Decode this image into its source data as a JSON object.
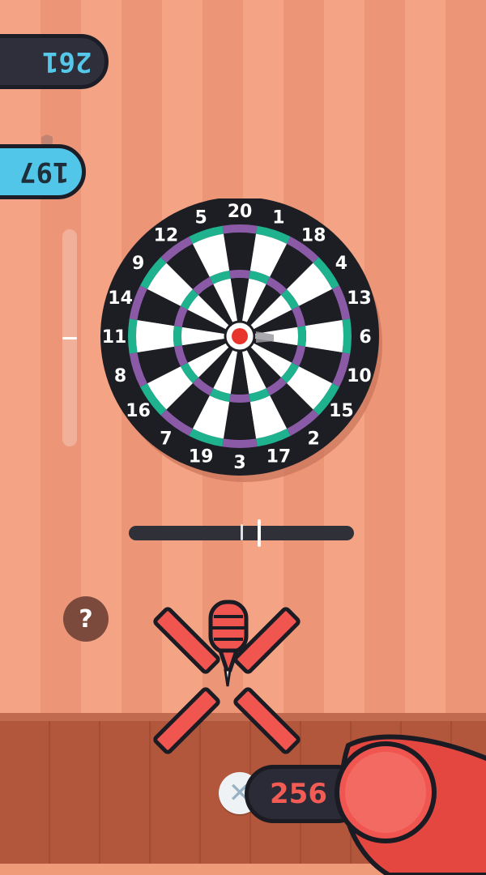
{
  "scores": {
    "opponent": "261",
    "player": "197"
  },
  "board": {
    "numbers": [
      "20",
      "1",
      "18",
      "4",
      "13",
      "6",
      "10",
      "15",
      "2",
      "17",
      "3",
      "19",
      "7",
      "16",
      "8",
      "11",
      "14",
      "9",
      "12",
      "5"
    ]
  },
  "aim": {
    "vertical_level": 0.5,
    "horizontal_level": 0.58,
    "horizontal_ref": 0.5
  },
  "help": {
    "label": "?"
  },
  "power": {
    "value": "256"
  },
  "close": {
    "label": "✕"
  },
  "colors": {
    "accent_green": "#1fb28e",
    "accent_purple": "#8a5aa6",
    "bull_red": "#e8352c",
    "score_blue": "#52c6e9",
    "power_red": "#f25c54"
  },
  "icons": [
    "shield-icon",
    "help-icon",
    "close-icon",
    "dart-icon",
    "throw-button-icon"
  ]
}
